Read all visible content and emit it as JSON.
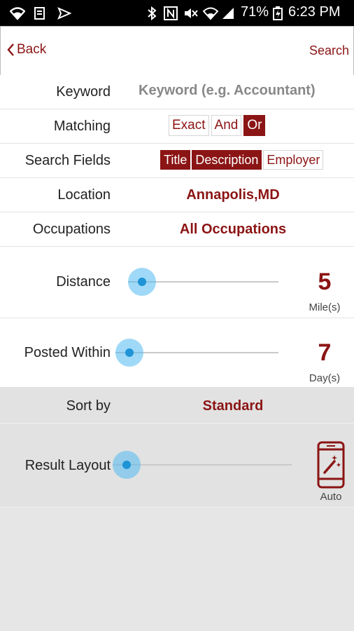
{
  "status_bar": {
    "battery": "71%",
    "time": "6:23 PM",
    "icons": [
      "wifi-icon",
      "image-icon",
      "send-icon",
      "bluetooth-icon",
      "nfc-icon",
      "mute-icon",
      "wifi-signal-icon",
      "cell-signal-icon",
      "battery-icon"
    ]
  },
  "nav": {
    "back_label": "Back",
    "search_label": "Search"
  },
  "form": {
    "keyword": {
      "label": "Keyword",
      "placeholder": "Keyword (e.g. Accountant)"
    },
    "matching": {
      "label": "Matching",
      "options": [
        "Exact",
        "And",
        "Or"
      ],
      "selected": "Or"
    },
    "search_fields": {
      "label": "Search Fields",
      "options": [
        "Title",
        "Description",
        "Employer"
      ],
      "selected": [
        "Title",
        "Description"
      ]
    },
    "location": {
      "label": "Location",
      "value": "Annapolis,MD"
    },
    "occupations": {
      "label": "Occupations",
      "value": "All Occupations"
    },
    "distance": {
      "label": "Distance",
      "value": "5",
      "unit": "Mile(s)",
      "slider_fraction": 0.0
    },
    "posted_within": {
      "label": "Posted Within",
      "value": "7",
      "unit": "Day(s)",
      "slider_fraction": 0.0
    },
    "sort_by": {
      "label": "Sort by",
      "value": "Standard"
    },
    "result_layout": {
      "label": "Result Layout",
      "value": "Auto",
      "icon": "phone-auto-rotate-icon",
      "slider_fraction": 0.0
    }
  },
  "colors": {
    "accent": "#8b1414",
    "slider": "#1e94d6",
    "background": "#e6e6e6"
  }
}
